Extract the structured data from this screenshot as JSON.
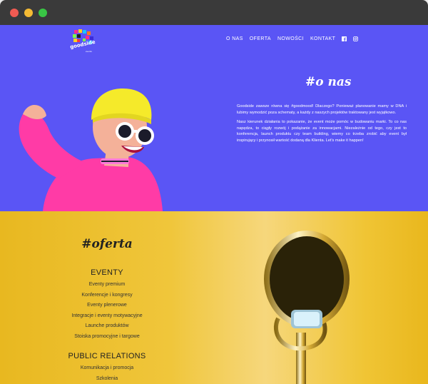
{
  "window": {
    "controls": [
      "close",
      "minimize",
      "maximize"
    ]
  },
  "brand": {
    "logo_text": "goodside",
    "logo_sub": "events"
  },
  "nav": {
    "items": [
      "O NAS",
      "OFERTA",
      "NOWOŚCI",
      "KONTAKT"
    ],
    "icons": [
      "facebook-icon",
      "instagram-icon"
    ]
  },
  "hero": {
    "title": "#o nas",
    "paragraph1": "Goodside zawsze równa się #goodmood! Dlaczego? Ponieważ planowanie mamy w DNA i lubimy wymodzić poza schematy, a każdy z naszych projektów traktowany jest wyjątkowo.",
    "paragraph2": "Nasz kierunek działania to pokazanie, że event może pomóc w budowaniu marki. To co nas napędza, to ciągły rozwój i podążanie za innowacjami. Niezależnie od tego, czy jest to konferencja, launch produktu czy team building, wiemy co trzeba zrobić aby event był inspirujący i przynosił wartość dodaną dla Klienta. Let's make it happen!",
    "background": "#5a55f5"
  },
  "offer": {
    "title": "#oferta",
    "eventy_heading": "EVENTY",
    "eventy_items": [
      "Eventy premium",
      "Konferencje i kongresy",
      "Eventy plenerowe",
      "Integracje i eventy motywacyjne",
      "Launche produktów",
      "Stoiska promocyjne i targowe"
    ],
    "pr_heading": "PUBLIC RELATIONS",
    "pr_items": [
      "Komunikacja i promocja",
      "Szkolenia"
    ],
    "background": "#f0c63b"
  }
}
